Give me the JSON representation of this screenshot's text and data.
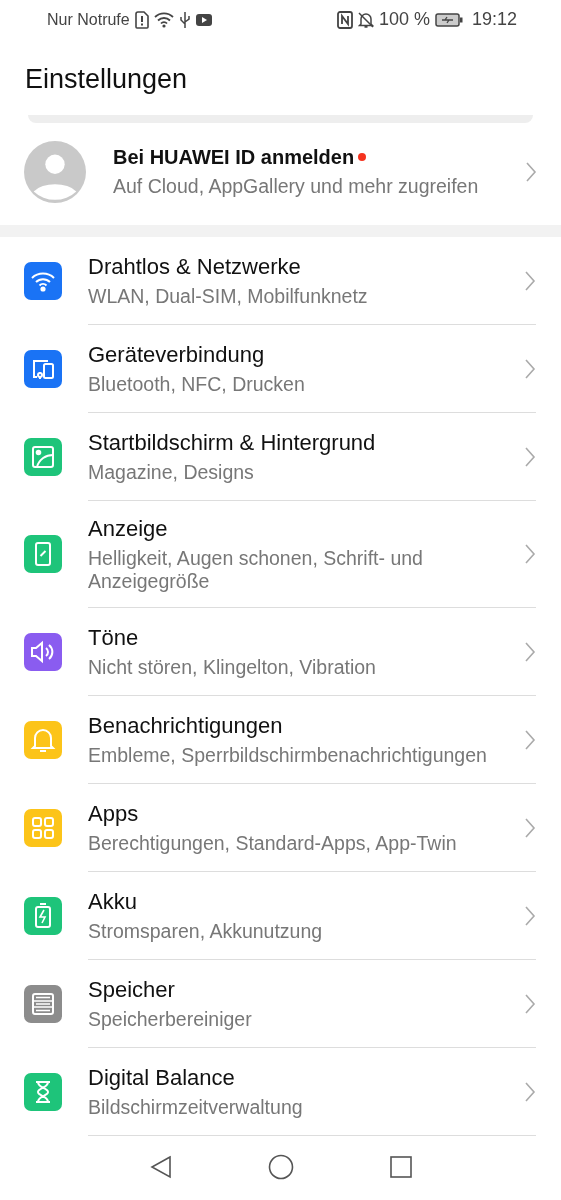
{
  "status_bar": {
    "carrier": "Nur Notrufe",
    "battery": "100 %",
    "time": "19:12"
  },
  "title": "Einstellungen",
  "account": {
    "name": "Bei HUAWEI ID anmelden",
    "subtitle": "Auf Cloud, AppGallery und mehr zugreifen",
    "badge": true
  },
  "items": [
    {
      "kind": "wifi",
      "color": "#1a73f5",
      "title": "Drahtlos & Netzwerke",
      "subtitle": "WLAN, Dual-SIM, Mobilfunknetz"
    },
    {
      "kind": "devices",
      "color": "#1a73f5",
      "title": "Geräteverbindung",
      "subtitle": "Bluetooth, NFC, Drucken"
    },
    {
      "kind": "image",
      "color": "#1ec47a",
      "title": "Startbildschirm & Hintergrund",
      "subtitle": "Magazine, Designs"
    },
    {
      "kind": "display",
      "color": "#1ec47a",
      "title": "Anzeige",
      "subtitle": "Helligkeit, Augen schonen, Schrift- und Anzeigegröße"
    },
    {
      "kind": "sound",
      "color": "#8a5cf0",
      "title": "Töne",
      "subtitle": "Nicht stören, Klingelton, Vibration"
    },
    {
      "kind": "bell",
      "color": "#fcc419",
      "title": "Benachrichtigungen",
      "subtitle": "Embleme, Sperrbildschirmbenachrichtigungen"
    },
    {
      "kind": "grid",
      "color": "#fcc419",
      "title": "Apps",
      "subtitle": "Berechtigungen, Standard-Apps, App-Twin"
    },
    {
      "kind": "battery",
      "color": "#1ec47a",
      "title": "Akku",
      "subtitle": "Stromsparen, Akkunutzung"
    },
    {
      "kind": "storage",
      "color": "#8c8c8c",
      "title": "Speicher",
      "subtitle": "Speicherbereiniger"
    },
    {
      "kind": "hourglass",
      "color": "#1ec47a",
      "title": "Digital Balance",
      "subtitle": "Bildschirmzeitverwaltung"
    }
  ]
}
